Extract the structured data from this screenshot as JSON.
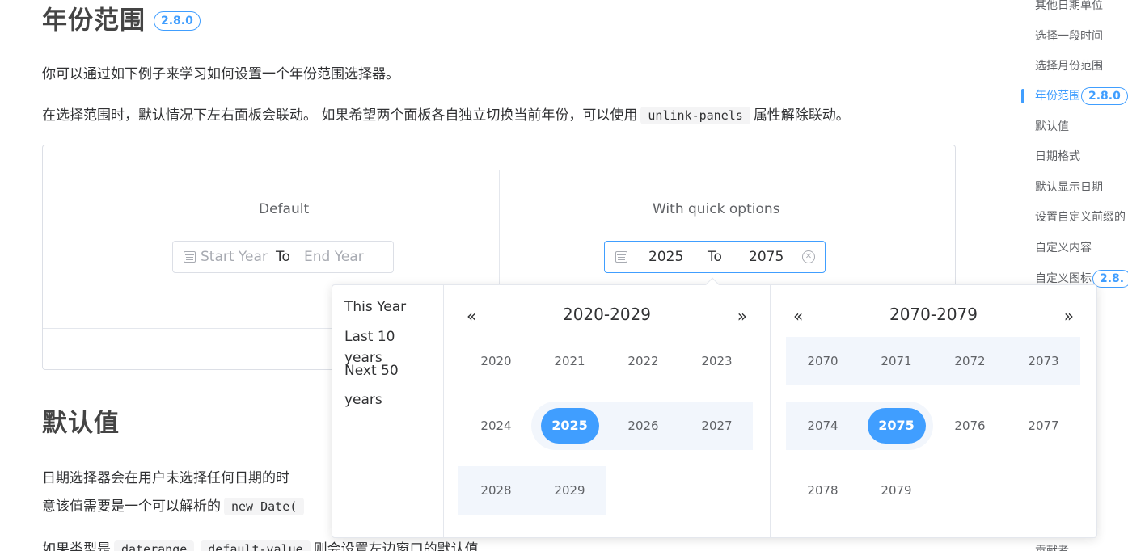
{
  "main": {
    "section_title": "年份范围",
    "section_badge": "2.8.0",
    "intro": "你可以通过如下例子来学习如何设置一个年份范围选择器。",
    "desc_before": "在选择范围时，默认情况下左右面板会联动。 如果希望两个面板各自独立切换当前年份，可以使用",
    "desc_code": "unlink-panels",
    "desc_after": "属性解除联动。",
    "demo": {
      "left_label": "Default",
      "left_start_placeholder": "Start Year",
      "left_separator": "To",
      "left_end_placeholder": "End Year",
      "right_label": "With quick options",
      "right_start_value": "2025",
      "right_separator": "To",
      "right_end_value": "2075"
    },
    "section2_title": "默认值",
    "p2_line1": "日期选择器会在用户未选择任何日期的时",
    "p2_line2_before": "意该值需要是一个可以解析的",
    "p2_line2_code": "new Date(",
    "p3_before": "如果类型是",
    "p3_code1": "daterange",
    "p3_code2": "default-value",
    "p3_after": "则会设置左边窗口的默认值"
  },
  "toc": {
    "items": [
      {
        "label": "其他日期单位"
      },
      {
        "label": "选择一段时间"
      },
      {
        "label": "选择月份范围"
      },
      {
        "label": "年份范围",
        "badge": "2.8.0",
        "active": true
      },
      {
        "label": "默认值"
      },
      {
        "label": "日期格式"
      },
      {
        "label": "默认显示日期"
      },
      {
        "label": "设置自定义前缀的"
      },
      {
        "label": "自定义内容"
      },
      {
        "label": "自定义图标",
        "badge": "2.8."
      }
    ],
    "bottom_item": "贡献者"
  },
  "picker": {
    "shortcuts": [
      "This Year",
      "Last 10 years",
      "Next 50 years"
    ],
    "left_panel": {
      "title": "2020-2029",
      "prev_icon": "«",
      "next_icon": "»",
      "years": [
        "2020",
        "2021",
        "2022",
        "2023",
        "2024",
        "2025",
        "2026",
        "2027",
        "2028",
        "2029"
      ],
      "selected": "2025"
    },
    "right_panel": {
      "title": "2070-2079",
      "prev_icon": "«",
      "next_icon": "»",
      "years": [
        "2070",
        "2071",
        "2072",
        "2073",
        "2074",
        "2075",
        "2076",
        "2077",
        "2078",
        "2079"
      ],
      "selected": "2075"
    },
    "colors": {
      "accent": "#409eff",
      "range_bg": "#f2f6fc"
    }
  }
}
